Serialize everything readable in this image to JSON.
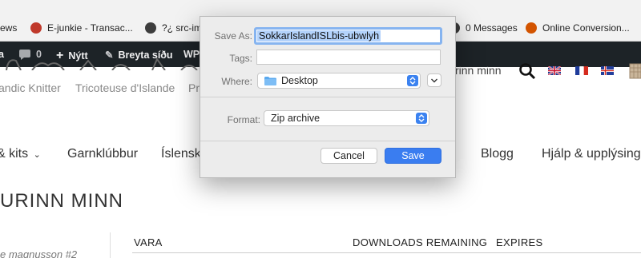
{
  "bookmarks": {
    "items": [
      {
        "label": "ews",
        "icon": "news-icon"
      },
      {
        "label": "E-junkie - Transac...",
        "icon": "ejunkie-icon"
      },
      {
        "label": "?¿ src-im",
        "icon": "globe-icon"
      },
      {
        "label": "0 Messages",
        "icon": "messages-icon"
      },
      {
        "label": "Online Conversion...",
        "icon": "conversion-icon"
      }
    ]
  },
  "adminbar": {
    "comments_count": "0",
    "new_label": "Nýtt",
    "edit_label": "Breyta síðu",
    "wp_label": "WP"
  },
  "site": {
    "tagline_1": "andic Knitter",
    "tagline_2": "Tricoteuse d'Islande",
    "tagline_3": "Pr",
    "right_partial": "rinn minn"
  },
  "nav": {
    "items": [
      "& kits",
      "Garnklúbbur",
      "Íslenskt",
      "Blogg",
      "Hjálp & upplýsingar"
    ]
  },
  "page": {
    "title": "URINN MINN",
    "sidebar_text": "e magnusson #2"
  },
  "table": {
    "headers": [
      "VARA",
      "DOWNLOADS REMAINING",
      "EXPIRES"
    ]
  },
  "dialog": {
    "save_as_label": "Save As:",
    "save_as_value": "SokkarIslandISLbis-ubwlyh",
    "tags_label": "Tags:",
    "tags_value": "",
    "where_label": "Where:",
    "where_value": "Desktop",
    "format_label": "Format:",
    "format_value": "Zip archive",
    "cancel_label": "Cancel",
    "save_label": "Save"
  },
  "colors": {
    "admin_bar": "#1d2327",
    "accent": "#3a7df0",
    "selection": "#b3d2fb"
  }
}
